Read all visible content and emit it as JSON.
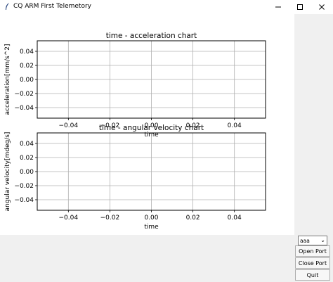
{
  "window": {
    "title": "CQ ARM First Telemetory",
    "icon": "feather-icon"
  },
  "controls": {
    "minimize_icon": "minimize-icon",
    "maximize_icon": "maximize-icon",
    "close_icon": "close-icon"
  },
  "sidebar": {
    "port_select_value": "aaa",
    "open_port_label": "Open Port",
    "close_port_label": "Close Port",
    "quit_label": "Quit"
  },
  "chart_data": [
    {
      "type": "line",
      "title": "time - acceleration chart",
      "xlabel": "time",
      "ylabel": "acceleration[mm/s^2]",
      "xlim": [
        -0.055,
        0.055
      ],
      "ylim": [
        -0.055,
        0.055
      ],
      "xticks": [
        "−0.04",
        "−0.02",
        "0.00",
        "0.02",
        "0.04"
      ],
      "yticks": [
        "0.04",
        "0.02",
        "0.00",
        "−0.02",
        "−0.04"
      ],
      "xtick_values": [
        -0.04,
        -0.02,
        0.0,
        0.02,
        0.04
      ],
      "ytick_values": [
        0.04,
        0.02,
        0.0,
        -0.02,
        -0.04
      ],
      "grid": true,
      "series": []
    },
    {
      "type": "line",
      "title": "time - angular velocity chart",
      "xlabel": "time",
      "ylabel": "angular velocity[mdeg/s]",
      "xlim": [
        -0.055,
        0.055
      ],
      "ylim": [
        -0.055,
        0.055
      ],
      "xticks": [
        "−0.04",
        "−0.02",
        "0.00",
        "0.02",
        "0.04"
      ],
      "yticks": [
        "0.04",
        "0.02",
        "0.00",
        "−0.02",
        "−0.04"
      ],
      "xtick_values": [
        -0.04,
        -0.02,
        0.0,
        0.02,
        0.04
      ],
      "ytick_values": [
        0.04,
        0.02,
        0.0,
        -0.02,
        -0.04
      ],
      "grid": true,
      "series": []
    }
  ]
}
